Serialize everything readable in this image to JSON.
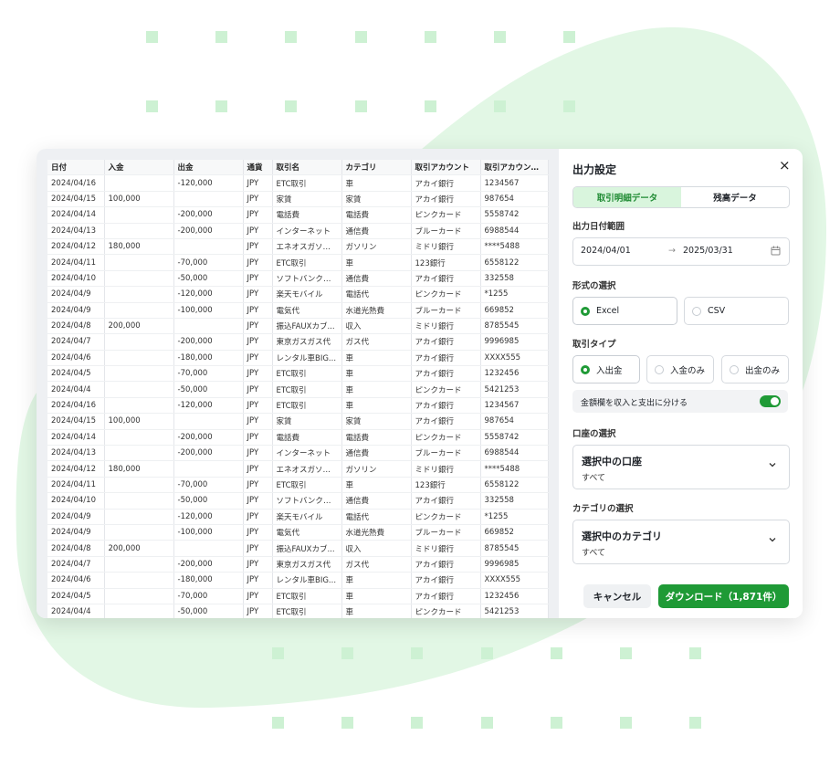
{
  "colors": {
    "accent": "#1f9a36",
    "accent_light": "#d9f5dd",
    "decor": "#e2f7e5"
  },
  "table": {
    "headers": [
      "日付",
      "入金",
      "出金",
      "通貨",
      "取引名",
      "カテゴリ",
      "取引アカウント",
      "取引アカウント..."
    ],
    "rows": [
      [
        "2024/04/16",
        "",
        "-120,000",
        "JPY",
        "ETC取引",
        "車",
        "アカイ銀行",
        "1234567"
      ],
      [
        "2024/04/15",
        "100,000",
        "",
        "JPY",
        "家賃",
        "家賃",
        "アカイ銀行",
        "987654"
      ],
      [
        "2024/04/14",
        "",
        "-200,000",
        "JPY",
        "電話費",
        "電話費",
        "ピンクカード",
        "5558742"
      ],
      [
        "2024/04/13",
        "",
        "-200,000",
        "JPY",
        "インターネット",
        "通信費",
        "ブルーカード",
        "6988544"
      ],
      [
        "2024/04/12",
        "180,000",
        "",
        "JPY",
        "エネオスガソリン",
        "ガソリン",
        "ミドリ銀行",
        "****5488"
      ],
      [
        "2024/04/11",
        "",
        "-70,000",
        "JPY",
        "ETC取引",
        "車",
        "123銀行",
        "6558122"
      ],
      [
        "2024/04/10",
        "",
        "-50,000",
        "JPY",
        "ソフトバンクイ...",
        "通信費",
        "アカイ銀行",
        "332558"
      ],
      [
        "2024/04/9",
        "",
        "-120,000",
        "JPY",
        "楽天モバイル",
        "電話代",
        "ピンクカード",
        "*1255"
      ],
      [
        "2024/04/9",
        "",
        "-100,000",
        "JPY",
        "電気代",
        "水道光熱費",
        "ブルーカード",
        "669852"
      ],
      [
        "2024/04/8",
        "200,000",
        "",
        "JPY",
        "振込FAUXカブ...",
        "収入",
        "ミドリ銀行",
        "8785545"
      ],
      [
        "2024/04/7",
        "",
        "-200,000",
        "JPY",
        "東京ガスガス代",
        "ガス代",
        "アカイ銀行",
        "9996985"
      ],
      [
        "2024/04/6",
        "",
        "-180,000",
        "JPY",
        "レンタル車BIG...",
        "車",
        "アカイ銀行",
        "XXXX555"
      ],
      [
        "2024/04/5",
        "",
        "-70,000",
        "JPY",
        "ETC取引",
        "車",
        "アカイ銀行",
        "1232456"
      ],
      [
        "2024/04/4",
        "",
        "-50,000",
        "JPY",
        "ETC取引",
        "車",
        "ピンクカード",
        "5421253"
      ],
      [
        "2024/04/16",
        "",
        "-120,000",
        "JPY",
        "ETC取引",
        "車",
        "アカイ銀行",
        "1234567"
      ],
      [
        "2024/04/15",
        "100,000",
        "",
        "JPY",
        "家賃",
        "家賃",
        "アカイ銀行",
        "987654"
      ],
      [
        "2024/04/14",
        "",
        "-200,000",
        "JPY",
        "電話費",
        "電話費",
        "ピンクカード",
        "5558742"
      ],
      [
        "2024/04/13",
        "",
        "-200,000",
        "JPY",
        "インターネット",
        "通信費",
        "ブルーカード",
        "6988544"
      ],
      [
        "2024/04/12",
        "180,000",
        "",
        "JPY",
        "エネオスガソリン",
        "ガソリン",
        "ミドリ銀行",
        "****5488"
      ],
      [
        "2024/04/11",
        "",
        "-70,000",
        "JPY",
        "ETC取引",
        "車",
        "123銀行",
        "6558122"
      ],
      [
        "2024/04/10",
        "",
        "-50,000",
        "JPY",
        "ソフトバンクイ...",
        "通信費",
        "アカイ銀行",
        "332558"
      ],
      [
        "2024/04/9",
        "",
        "-120,000",
        "JPY",
        "楽天モバイル",
        "電話代",
        "ピンクカード",
        "*1255"
      ],
      [
        "2024/04/9",
        "",
        "-100,000",
        "JPY",
        "電気代",
        "水道光熱費",
        "ブルーカード",
        "669852"
      ],
      [
        "2024/04/8",
        "200,000",
        "",
        "JPY",
        "振込FAUXカブ...",
        "収入",
        "ミドリ銀行",
        "8785545"
      ],
      [
        "2024/04/7",
        "",
        "-200,000",
        "JPY",
        "東京ガスガス代",
        "ガス代",
        "アカイ銀行",
        "9996985"
      ],
      [
        "2024/04/6",
        "",
        "-180,000",
        "JPY",
        "レンタル車BIG...",
        "車",
        "アカイ銀行",
        "XXXX555"
      ],
      [
        "2024/04/5",
        "",
        "-70,000",
        "JPY",
        "ETC取引",
        "車",
        "アカイ銀行",
        "1232456"
      ],
      [
        "2024/04/4",
        "",
        "-50,000",
        "JPY",
        "ETC取引",
        "車",
        "ピンクカード",
        "5421253"
      ]
    ]
  },
  "panel": {
    "title": "出力設定",
    "close_icon": "×",
    "tabs": {
      "detail": "取引明細データ",
      "balance": "残高データ"
    },
    "date_range": {
      "label": "出力日付範囲",
      "start": "2024/04/01",
      "arrow": "→",
      "end": "2025/03/31"
    },
    "format": {
      "label": "形式の選択",
      "excel": "Excel",
      "csv": "CSV"
    },
    "tx_type": {
      "label": "取引タイプ",
      "both": "入出金",
      "in_only": "入金のみ",
      "out_only": "出金のみ"
    },
    "split": {
      "label": "金額欄を収入と支出に分ける"
    },
    "account": {
      "label": "口座の選択",
      "title": "選択中の口座",
      "value": "すべて"
    },
    "category": {
      "label": "カテゴリの選択",
      "title": "選択中のカテゴリ",
      "value": "すべて"
    },
    "cancel": "キャンセル",
    "download": "ダウンロード（1,871件）"
  }
}
